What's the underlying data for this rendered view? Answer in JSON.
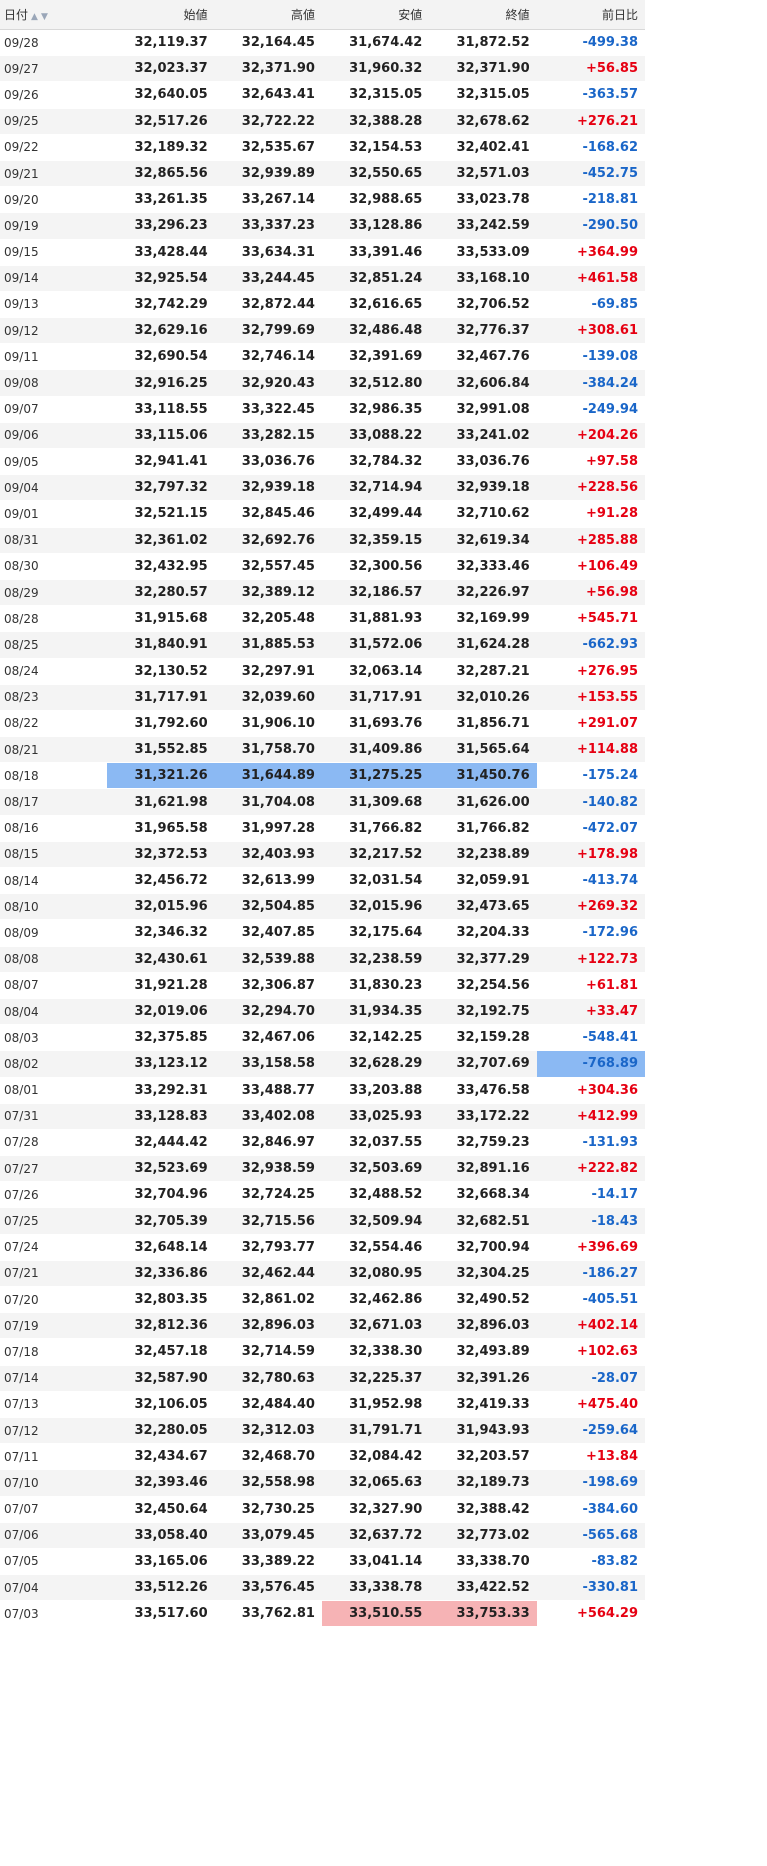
{
  "header": {
    "date": "日付",
    "open": "始値",
    "high": "高値",
    "low": "安値",
    "close": "終値",
    "change": "前日比"
  },
  "colors": {
    "up": "#e60012",
    "down": "#1a66c8",
    "highlight_blue": "#8bb9f3",
    "highlight_pink": "#f6b3b5"
  },
  "rows": [
    {
      "date": "09/28",
      "open": "32,119.37",
      "high": "32,164.45",
      "low": "31,674.42",
      "close": "31,872.52",
      "change": "-499.38"
    },
    {
      "date": "09/27",
      "open": "32,023.37",
      "high": "32,371.90",
      "low": "31,960.32",
      "close": "32,371.90",
      "change": "+56.85"
    },
    {
      "date": "09/26",
      "open": "32,640.05",
      "high": "32,643.41",
      "low": "32,315.05",
      "close": "32,315.05",
      "change": "-363.57"
    },
    {
      "date": "09/25",
      "open": "32,517.26",
      "high": "32,722.22",
      "low": "32,388.28",
      "close": "32,678.62",
      "change": "+276.21"
    },
    {
      "date": "09/22",
      "open": "32,189.32",
      "high": "32,535.67",
      "low": "32,154.53",
      "close": "32,402.41",
      "change": "-168.62"
    },
    {
      "date": "09/21",
      "open": "32,865.56",
      "high": "32,939.89",
      "low": "32,550.65",
      "close": "32,571.03",
      "change": "-452.75"
    },
    {
      "date": "09/20",
      "open": "33,261.35",
      "high": "33,267.14",
      "low": "32,988.65",
      "close": "33,023.78",
      "change": "-218.81"
    },
    {
      "date": "09/19",
      "open": "33,296.23",
      "high": "33,337.23",
      "low": "33,128.86",
      "close": "33,242.59",
      "change": "-290.50"
    },
    {
      "date": "09/15",
      "open": "33,428.44",
      "high": "33,634.31",
      "low": "33,391.46",
      "close": "33,533.09",
      "change": "+364.99"
    },
    {
      "date": "09/14",
      "open": "32,925.54",
      "high": "33,244.45",
      "low": "32,851.24",
      "close": "33,168.10",
      "change": "+461.58"
    },
    {
      "date": "09/13",
      "open": "32,742.29",
      "high": "32,872.44",
      "low": "32,616.65",
      "close": "32,706.52",
      "change": "-69.85"
    },
    {
      "date": "09/12",
      "open": "32,629.16",
      "high": "32,799.69",
      "low": "32,486.48",
      "close": "32,776.37",
      "change": "+308.61"
    },
    {
      "date": "09/11",
      "open": "32,690.54",
      "high": "32,746.14",
      "low": "32,391.69",
      "close": "32,467.76",
      "change": "-139.08"
    },
    {
      "date": "09/08",
      "open": "32,916.25",
      "high": "32,920.43",
      "low": "32,512.80",
      "close": "32,606.84",
      "change": "-384.24"
    },
    {
      "date": "09/07",
      "open": "33,118.55",
      "high": "33,322.45",
      "low": "32,986.35",
      "close": "32,991.08",
      "change": "-249.94"
    },
    {
      "date": "09/06",
      "open": "33,115.06",
      "high": "33,282.15",
      "low": "33,088.22",
      "close": "33,241.02",
      "change": "+204.26"
    },
    {
      "date": "09/05",
      "open": "32,941.41",
      "high": "33,036.76",
      "low": "32,784.32",
      "close": "33,036.76",
      "change": "+97.58"
    },
    {
      "date": "09/04",
      "open": "32,797.32",
      "high": "32,939.18",
      "low": "32,714.94",
      "close": "32,939.18",
      "change": "+228.56"
    },
    {
      "date": "09/01",
      "open": "32,521.15",
      "high": "32,845.46",
      "low": "32,499.44",
      "close": "32,710.62",
      "change": "+91.28"
    },
    {
      "date": "08/31",
      "open": "32,361.02",
      "high": "32,692.76",
      "low": "32,359.15",
      "close": "32,619.34",
      "change": "+285.88"
    },
    {
      "date": "08/30",
      "open": "32,432.95",
      "high": "32,557.45",
      "low": "32,300.56",
      "close": "32,333.46",
      "change": "+106.49"
    },
    {
      "date": "08/29",
      "open": "32,280.57",
      "high": "32,389.12",
      "low": "32,186.57",
      "close": "32,226.97",
      "change": "+56.98"
    },
    {
      "date": "08/28",
      "open": "31,915.68",
      "high": "32,205.48",
      "low": "31,881.93",
      "close": "32,169.99",
      "change": "+545.71"
    },
    {
      "date": "08/25",
      "open": "31,840.91",
      "high": "31,885.53",
      "low": "31,572.06",
      "close": "31,624.28",
      "change": "-662.93"
    },
    {
      "date": "08/24",
      "open": "32,130.52",
      "high": "32,297.91",
      "low": "32,063.14",
      "close": "32,287.21",
      "change": "+276.95"
    },
    {
      "date": "08/23",
      "open": "31,717.91",
      "high": "32,039.60",
      "low": "31,717.91",
      "close": "32,010.26",
      "change": "+153.55"
    },
    {
      "date": "08/22",
      "open": "31,792.60",
      "high": "31,906.10",
      "low": "31,693.76",
      "close": "31,856.71",
      "change": "+291.07"
    },
    {
      "date": "08/21",
      "open": "31,552.85",
      "high": "31,758.70",
      "low": "31,409.86",
      "close": "31,565.64",
      "change": "+114.88"
    },
    {
      "date": "08/18",
      "open": "31,321.26",
      "high": "31,644.89",
      "low": "31,275.25",
      "close": "31,450.76",
      "change": "-175.24",
      "hl": {
        "open": "blue",
        "high": "blue",
        "low": "blue",
        "close": "blue"
      }
    },
    {
      "date": "08/17",
      "open": "31,621.98",
      "high": "31,704.08",
      "low": "31,309.68",
      "close": "31,626.00",
      "change": "-140.82"
    },
    {
      "date": "08/16",
      "open": "31,965.58",
      "high": "31,997.28",
      "low": "31,766.82",
      "close": "31,766.82",
      "change": "-472.07"
    },
    {
      "date": "08/15",
      "open": "32,372.53",
      "high": "32,403.93",
      "low": "32,217.52",
      "close": "32,238.89",
      "change": "+178.98"
    },
    {
      "date": "08/14",
      "open": "32,456.72",
      "high": "32,613.99",
      "low": "32,031.54",
      "close": "32,059.91",
      "change": "-413.74"
    },
    {
      "date": "08/10",
      "open": "32,015.96",
      "high": "32,504.85",
      "low": "32,015.96",
      "close": "32,473.65",
      "change": "+269.32"
    },
    {
      "date": "08/09",
      "open": "32,346.32",
      "high": "32,407.85",
      "low": "32,175.64",
      "close": "32,204.33",
      "change": "-172.96"
    },
    {
      "date": "08/08",
      "open": "32,430.61",
      "high": "32,539.88",
      "low": "32,238.59",
      "close": "32,377.29",
      "change": "+122.73"
    },
    {
      "date": "08/07",
      "open": "31,921.28",
      "high": "32,306.87",
      "low": "31,830.23",
      "close": "32,254.56",
      "change": "+61.81"
    },
    {
      "date": "08/04",
      "open": "32,019.06",
      "high": "32,294.70",
      "low": "31,934.35",
      "close": "32,192.75",
      "change": "+33.47"
    },
    {
      "date": "08/03",
      "open": "32,375.85",
      "high": "32,467.06",
      "low": "32,142.25",
      "close": "32,159.28",
      "change": "-548.41"
    },
    {
      "date": "08/02",
      "open": "33,123.12",
      "high": "33,158.58",
      "low": "32,628.29",
      "close": "32,707.69",
      "change": "-768.89",
      "hl": {
        "change": "blue"
      }
    },
    {
      "date": "08/01",
      "open": "33,292.31",
      "high": "33,488.77",
      "low": "33,203.88",
      "close": "33,476.58",
      "change": "+304.36"
    },
    {
      "date": "07/31",
      "open": "33,128.83",
      "high": "33,402.08",
      "low": "33,025.93",
      "close": "33,172.22",
      "change": "+412.99"
    },
    {
      "date": "07/28",
      "open": "32,444.42",
      "high": "32,846.97",
      "low": "32,037.55",
      "close": "32,759.23",
      "change": "-131.93"
    },
    {
      "date": "07/27",
      "open": "32,523.69",
      "high": "32,938.59",
      "low": "32,503.69",
      "close": "32,891.16",
      "change": "+222.82"
    },
    {
      "date": "07/26",
      "open": "32,704.96",
      "high": "32,724.25",
      "low": "32,488.52",
      "close": "32,668.34",
      "change": "-14.17"
    },
    {
      "date": "07/25",
      "open": "32,705.39",
      "high": "32,715.56",
      "low": "32,509.94",
      "close": "32,682.51",
      "change": "-18.43"
    },
    {
      "date": "07/24",
      "open": "32,648.14",
      "high": "32,793.77",
      "low": "32,554.46",
      "close": "32,700.94",
      "change": "+396.69"
    },
    {
      "date": "07/21",
      "open": "32,336.86",
      "high": "32,462.44",
      "low": "32,080.95",
      "close": "32,304.25",
      "change": "-186.27"
    },
    {
      "date": "07/20",
      "open": "32,803.35",
      "high": "32,861.02",
      "low": "32,462.86",
      "close": "32,490.52",
      "change": "-405.51"
    },
    {
      "date": "07/19",
      "open": "32,812.36",
      "high": "32,896.03",
      "low": "32,671.03",
      "close": "32,896.03",
      "change": "+402.14"
    },
    {
      "date": "07/18",
      "open": "32,457.18",
      "high": "32,714.59",
      "low": "32,338.30",
      "close": "32,493.89",
      "change": "+102.63"
    },
    {
      "date": "07/14",
      "open": "32,587.90",
      "high": "32,780.63",
      "low": "32,225.37",
      "close": "32,391.26",
      "change": "-28.07"
    },
    {
      "date": "07/13",
      "open": "32,106.05",
      "high": "32,484.40",
      "low": "31,952.98",
      "close": "32,419.33",
      "change": "+475.40"
    },
    {
      "date": "07/12",
      "open": "32,280.05",
      "high": "32,312.03",
      "low": "31,791.71",
      "close": "31,943.93",
      "change": "-259.64"
    },
    {
      "date": "07/11",
      "open": "32,434.67",
      "high": "32,468.70",
      "low": "32,084.42",
      "close": "32,203.57",
      "change": "+13.84"
    },
    {
      "date": "07/10",
      "open": "32,393.46",
      "high": "32,558.98",
      "low": "32,065.63",
      "close": "32,189.73",
      "change": "-198.69"
    },
    {
      "date": "07/07",
      "open": "32,450.64",
      "high": "32,730.25",
      "low": "32,327.90",
      "close": "32,388.42",
      "change": "-384.60"
    },
    {
      "date": "07/06",
      "open": "33,058.40",
      "high": "33,079.45",
      "low": "32,637.72",
      "close": "32,773.02",
      "change": "-565.68"
    },
    {
      "date": "07/05",
      "open": "33,165.06",
      "high": "33,389.22",
      "low": "33,041.14",
      "close": "33,338.70",
      "change": "-83.82"
    },
    {
      "date": "07/04",
      "open": "33,512.26",
      "high": "33,576.45",
      "low": "33,338.78",
      "close": "33,422.52",
      "change": "-330.81"
    },
    {
      "date": "07/03",
      "open": "33,517.60",
      "high": "33,762.81",
      "low": "33,510.55",
      "close": "33,753.33",
      "change": "+564.29",
      "hl": {
        "low": "pink",
        "close": "pink"
      }
    }
  ]
}
